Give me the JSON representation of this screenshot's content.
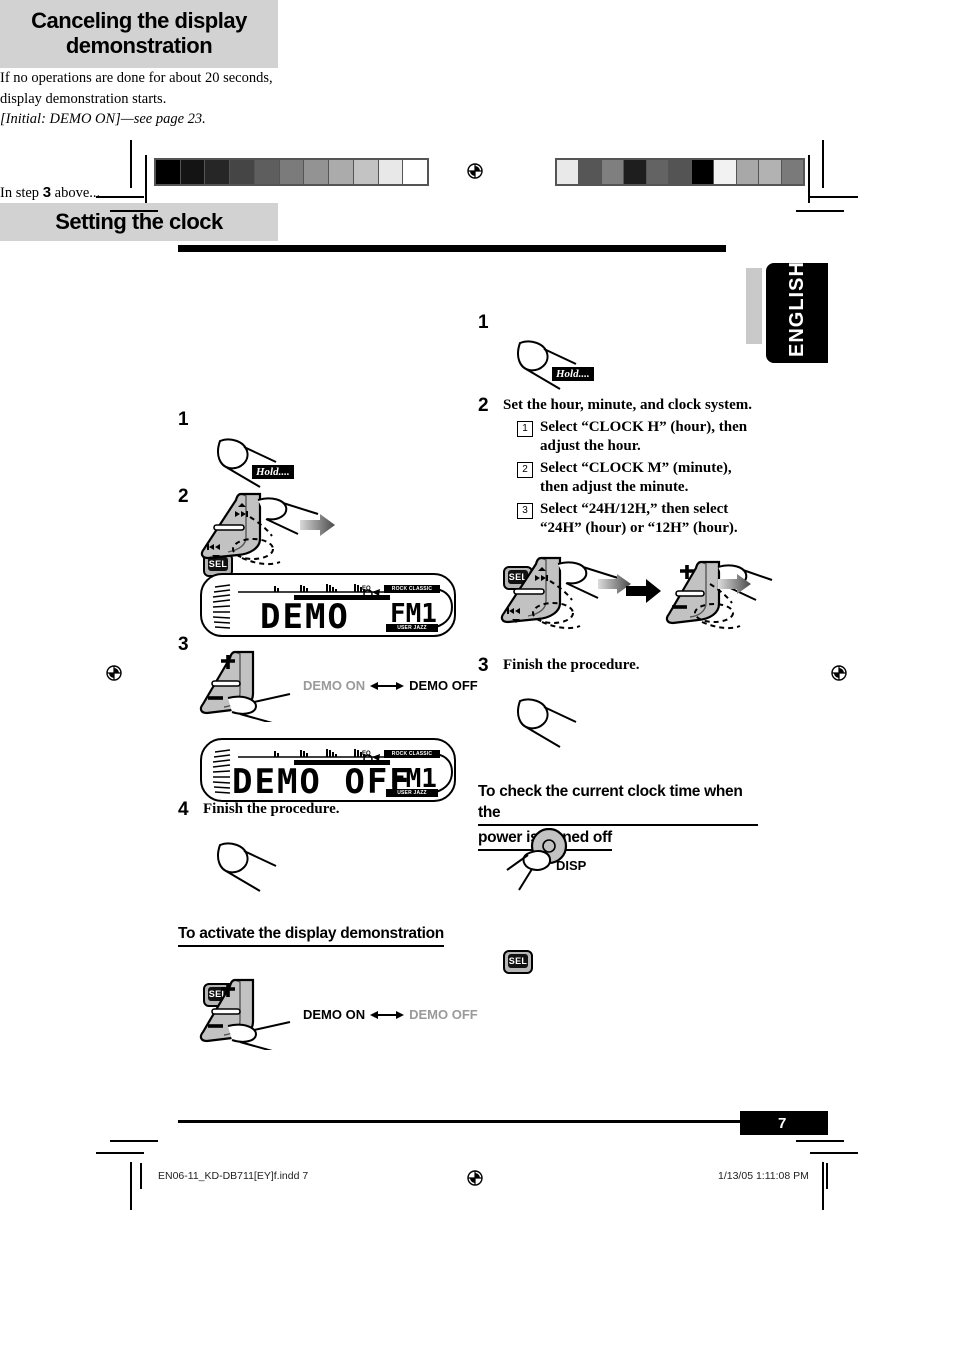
{
  "page": {
    "language_tab": "ENGLISH",
    "page_number": "7",
    "footer_left": "EN06-11_KD-DB711[EY]f.indd   7",
    "footer_right": "1/13/05   1:11:08 PM"
  },
  "left_column": {
    "heading_line1": "Canceling the display",
    "heading_line2": "demonstration",
    "intro_line1": "If no operations are done for about 20 seconds,",
    "intro_line2": "display demonstration starts.",
    "intro_line3": "[Initial: DEMO ON]—see page 23.",
    "steps": [
      {
        "num": "1",
        "text": ""
      },
      {
        "num": "2",
        "text": ""
      },
      {
        "num": "3",
        "text": ""
      },
      {
        "num": "4",
        "text": "Finish the procedure."
      }
    ],
    "button_sel_label": "SEL",
    "hold_label": "Hold....",
    "lcd1": {
      "main": "DEMO",
      "band": "FM1",
      "tag_top": "ROCK CLASSIC",
      "tag_bottom": "USER JAZZ",
      "tag_right": "POPS"
    },
    "lcd2": {
      "main": "DEMO OFF",
      "band": "FM1",
      "tag_top": "ROCK CLASSIC",
      "tag_bottom": "USER JAZZ",
      "tag_right": "POPS"
    },
    "toggle1": {
      "on": "DEMO ON",
      "off": "DEMO OFF",
      "active": "off"
    },
    "activate_heading": "To activate the display demonstration",
    "activate_note_pre": "In step ",
    "activate_note_num": "3",
    "activate_note_post": " above...",
    "toggle2": {
      "on": "DEMO ON",
      "off": "DEMO OFF",
      "active": "on"
    }
  },
  "right_column": {
    "heading": "Setting the clock",
    "steps": [
      {
        "num": "1",
        "text": ""
      },
      {
        "num": "2",
        "text": "Set the hour, minute, and clock system."
      },
      {
        "num": "3",
        "text": "Finish the procedure."
      }
    ],
    "substeps": [
      {
        "marker": "1",
        "text": "Select “CLOCK H” (hour), then adjust the hour."
      },
      {
        "marker": "2",
        "text": "Select “CLOCK M” (minute), then adjust the minute."
      },
      {
        "marker": "3",
        "text": "Select “24H/12H,” then select “24H” (hour) or “12H” (hour)."
      }
    ],
    "button_sel_label": "SEL",
    "hold_label": "Hold....",
    "check_heading_line1": "To check the current clock time when the",
    "check_heading_line2": "power is turned off",
    "disp_label": "DISP"
  },
  "calibration": {
    "left_strip": [
      "#000000",
      "#141414",
      "#262626",
      "#454545",
      "#5e5e5e",
      "#7b7b7b",
      "#939393",
      "#ababab",
      "#c3c3c3",
      "#e8e8e8",
      "#ffffff"
    ],
    "right_strip": [
      "#e9e9e9",
      "#565656",
      "#7f7f7f",
      "#1e1e1e",
      "#636363",
      "#545454",
      "#000000",
      "#f2f2f2",
      "#a8a8a8",
      "#b2b2b2",
      "#7a7a7a"
    ]
  }
}
